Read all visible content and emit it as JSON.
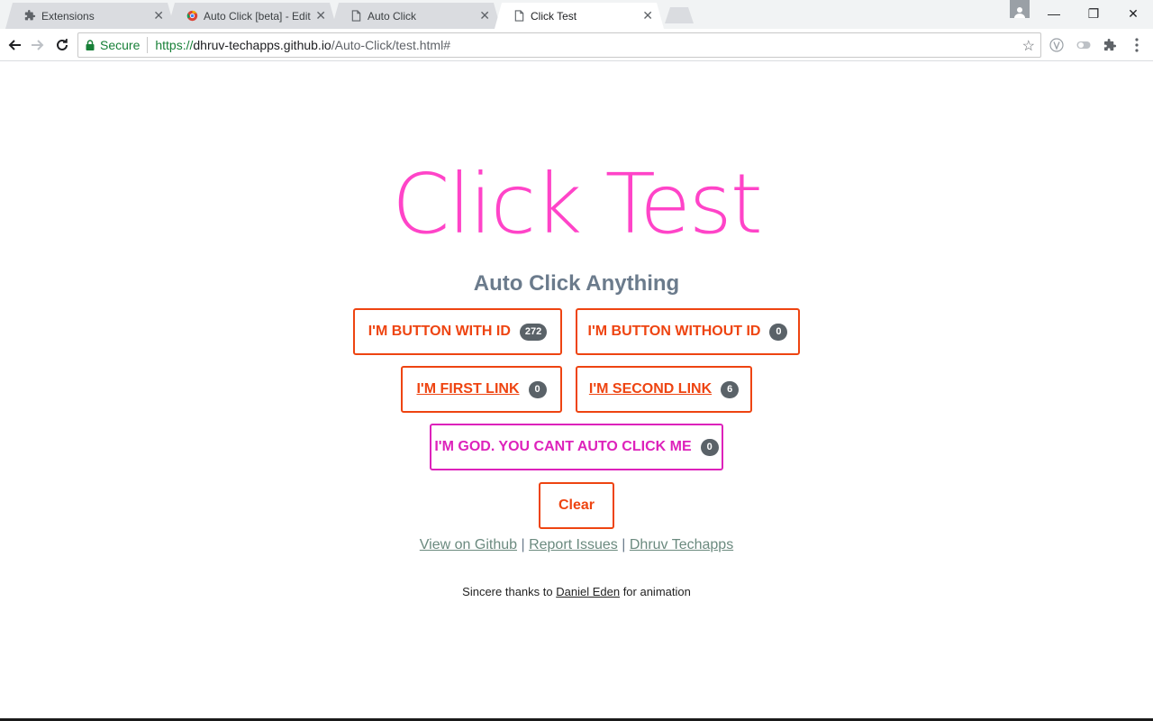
{
  "browser": {
    "tabs": [
      {
        "title": "Extensions",
        "icon": "puzzle-icon"
      },
      {
        "title": "Auto Click [beta] - Edit It",
        "icon": "chrome-store-icon"
      },
      {
        "title": "Auto Click",
        "icon": "page-icon"
      },
      {
        "title": "Click Test",
        "icon": "page-icon"
      }
    ],
    "active_tab_index": 3,
    "close_glyph": "✕",
    "window_controls": {
      "minimize": "—",
      "restore": "❐",
      "close": "✕"
    },
    "security_label": "Secure",
    "url": {
      "scheme": "https://",
      "host": "dhruv-techapps.github.io",
      "path": "/Auto-Click/test.html#"
    },
    "star_glyph": "☆"
  },
  "page": {
    "hero_title": "Click Test",
    "subtitle": "Auto Click Anything",
    "buttons": {
      "with_id": {
        "label": "I'M BUTTON WITH ID",
        "count": "272"
      },
      "without_id": {
        "label": "I'M BUTTON WITHOUT ID",
        "count": "0"
      },
      "first_link": {
        "label": "I'M FIRST LINK",
        "count": "0"
      },
      "second_link": {
        "label": "I'M SECOND LINK",
        "count": "6"
      },
      "god": {
        "label": "I'M GOD. YOU CANT AUTO CLICK ME",
        "count": "0"
      },
      "clear": {
        "label": "Clear"
      }
    },
    "footer_links": {
      "github": "View on Github",
      "issues": "Report Issues",
      "author": "Dhruv Techapps",
      "separator": "|"
    },
    "thanks": {
      "prefix": "Sincere thanks to",
      "link": "Daniel Eden",
      "suffix": "for animation"
    }
  },
  "colors": {
    "hero": "#ff44c8",
    "accent": "#ee4411",
    "god": "#dd22bb",
    "badge": "#5a6268",
    "subtitle": "#6b7b8c"
  }
}
